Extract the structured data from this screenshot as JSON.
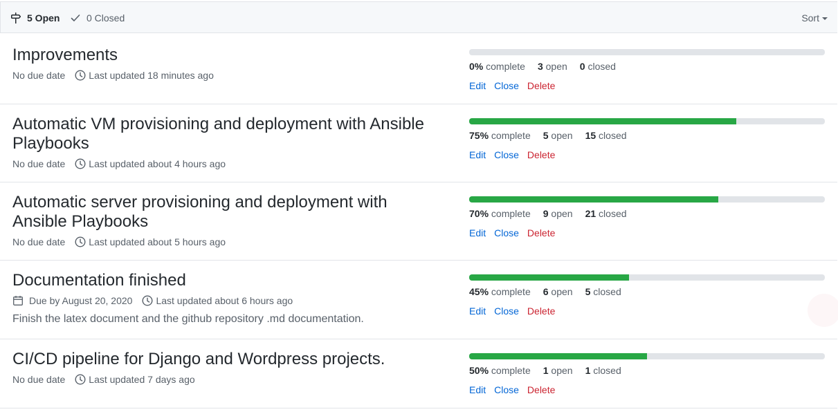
{
  "header": {
    "open_label": "5 Open",
    "closed_label": "0 Closed",
    "sort_label": "Sort"
  },
  "milestones": [
    {
      "title": "Improvements",
      "due": "No due date",
      "updated": "Last updated 18 minutes ago",
      "description": "",
      "percent": "0%",
      "percent_value": 0,
      "open_count": "3",
      "closed_count": "0"
    },
    {
      "title": "Automatic VM provisioning and deployment with Ansible Playbooks",
      "due": "No due date",
      "updated": "Last updated about 4 hours ago",
      "description": "",
      "percent": "75%",
      "percent_value": 75,
      "open_count": "5",
      "closed_count": "15"
    },
    {
      "title": "Automatic server provisioning and deployment with Ansible Playbooks",
      "due": "No due date",
      "updated": "Last updated about 5 hours ago",
      "description": "",
      "percent": "70%",
      "percent_value": 70,
      "open_count": "9",
      "closed_count": "21"
    },
    {
      "title": "Documentation finished",
      "due": "Due by August 20, 2020",
      "updated": "Last updated about 6 hours ago",
      "description": "Finish the latex document and the github repository .md documentation.",
      "percent": "45%",
      "percent_value": 45,
      "open_count": "6",
      "closed_count": "5"
    },
    {
      "title": "CI/CD pipeline for Django and Wordpress projects.",
      "due": "No due date",
      "updated": "Last updated 7 days ago",
      "description": "",
      "percent": "50%",
      "percent_value": 50,
      "open_count": "1",
      "closed_count": "1"
    }
  ],
  "labels": {
    "complete": "complete",
    "open": "open",
    "closed": "closed",
    "edit": "Edit",
    "close": "Close",
    "delete": "Delete"
  },
  "icons": {
    "open": "milestone-icon",
    "closed": "check-icon",
    "clock": "clock-icon",
    "calendar": "calendar-icon"
  },
  "colors": {
    "progress_fill": "#28a745",
    "progress_track": "#e1e4e8",
    "link": "#0366d6",
    "danger": "#cb2431"
  }
}
